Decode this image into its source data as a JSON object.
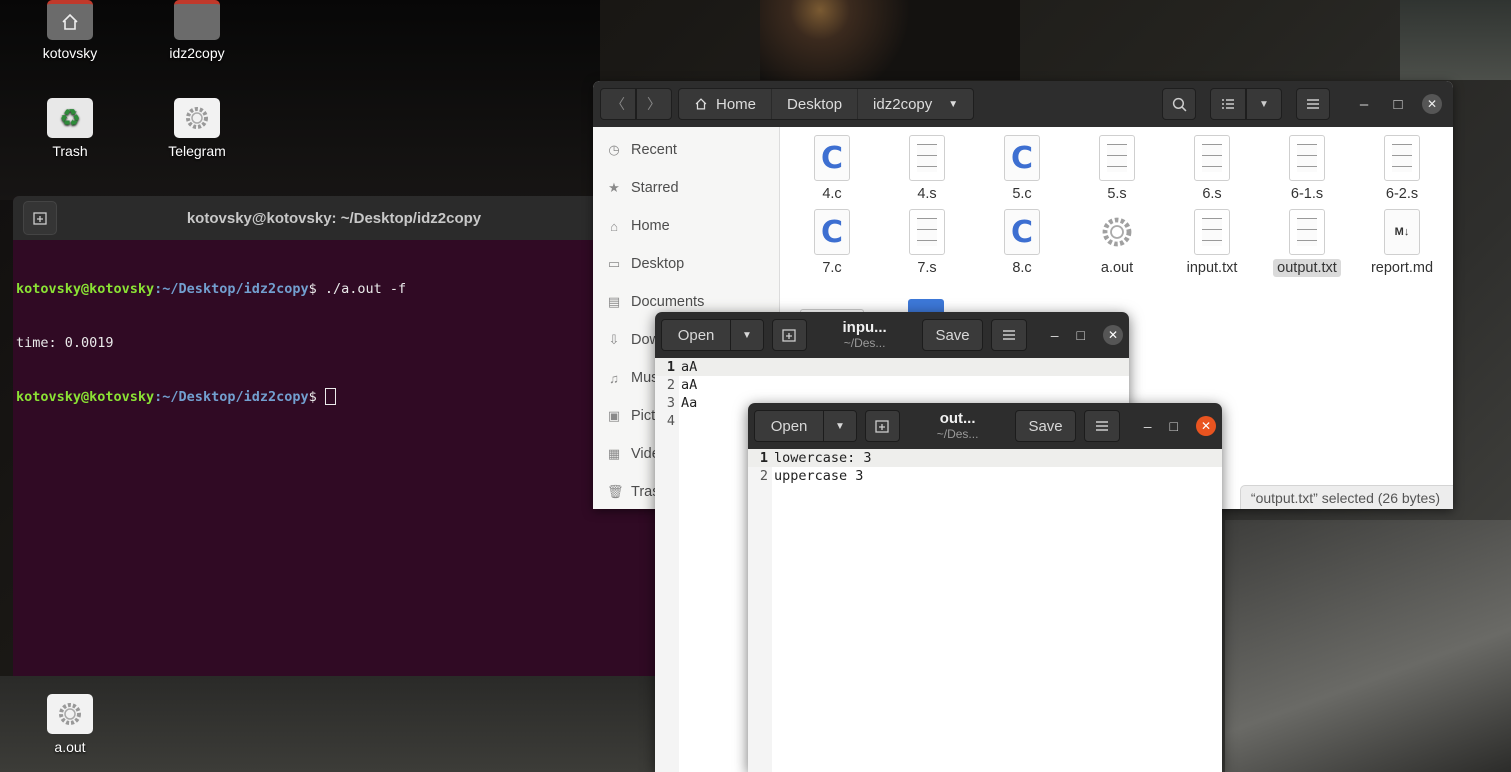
{
  "desktop": {
    "icons": [
      {
        "label": "kotovsky",
        "icon": "home-folder-icon"
      },
      {
        "label": "idz2copy",
        "icon": "folder-icon"
      },
      {
        "label": "Trash",
        "icon": "trash-icon"
      },
      {
        "label": "Telegram",
        "icon": "telegram-icon"
      },
      {
        "label": "a.out",
        "icon": "executable-icon"
      }
    ]
  },
  "terminal": {
    "title": "kotovsky@kotovsky: ~/Desktop/idz2copy",
    "lines": [
      {
        "user": "kotovsky@kotovsky",
        "path": ":~/Desktop/idz2copy",
        "prompt": "$ ",
        "cmd": "./a.out -f"
      },
      {
        "output": "time: 0.0019"
      },
      {
        "user": "kotovsky@kotovsky",
        "path": ":~/Desktop/idz2copy",
        "prompt": "$ ",
        "cmd": ""
      }
    ]
  },
  "files": {
    "breadcrumbs": [
      "Home",
      "Desktop",
      "idz2copy"
    ],
    "sidebar": [
      "Recent",
      "Starred",
      "Home",
      "Desktop",
      "Documents",
      "Dow",
      "Mus",
      "Pict",
      "Vide",
      "Tras"
    ],
    "items": [
      {
        "name": "4.c",
        "kind": "c"
      },
      {
        "name": "4.s",
        "kind": "text"
      },
      {
        "name": "5.c",
        "kind": "c"
      },
      {
        "name": "5.s",
        "kind": "text"
      },
      {
        "name": "6.s",
        "kind": "text"
      },
      {
        "name": "6-1.s",
        "kind": "text"
      },
      {
        "name": "6-2.s",
        "kind": "text"
      },
      {
        "name": "7.c",
        "kind": "c"
      },
      {
        "name": "7.s",
        "kind": "text"
      },
      {
        "name": "8.c",
        "kind": "c"
      },
      {
        "name": "a.out",
        "kind": "exec"
      },
      {
        "name": "input.txt",
        "kind": "text"
      },
      {
        "name": "output.txt",
        "kind": "text",
        "selected": true
      },
      {
        "name": "report.md",
        "kind": "md"
      }
    ],
    "status": "“output.txt” selected  (26 bytes)"
  },
  "gedit_input": {
    "open_label": "Open",
    "save_label": "Save",
    "title": "inpu...",
    "path": "~/Des...",
    "lines": [
      {
        "num": "1",
        "text": "aA"
      },
      {
        "num": "2",
        "text": "aA"
      },
      {
        "num": "3",
        "text": "Aa"
      },
      {
        "num": "4",
        "text": ""
      }
    ]
  },
  "gedit_output": {
    "open_label": "Open",
    "save_label": "Save",
    "title": "out...",
    "path": "~/Des...",
    "lines": [
      {
        "num": "1",
        "text": "lowercase: 3"
      },
      {
        "num": "2",
        "text": "uppercase 3"
      }
    ]
  },
  "colors": {
    "terminal_bg": "#300a24",
    "prompt_user": "#8ae234",
    "prompt_path": "#729fcf",
    "close_active": "#e95420"
  }
}
